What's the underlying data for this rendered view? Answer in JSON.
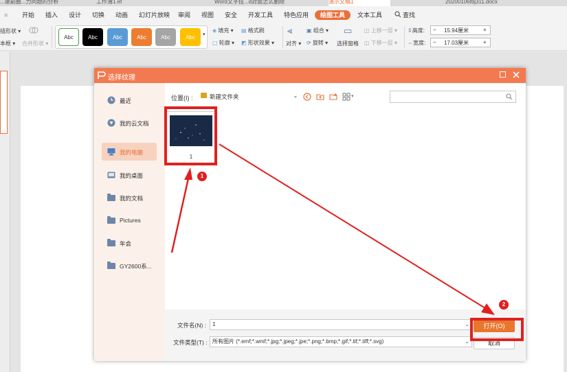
{
  "tabstrip": {
    "tabs": [
      {
        "label": "...速箭曲...力同题的分析"
      },
      {
        "label": "工作簿1.et"
      },
      {
        "label": "Word文字技...d封面怎么删除"
      },
      {
        "label": "演示文稿1"
      },
      {
        "label": "20200106fbj311.docx"
      }
    ]
  },
  "menu": {
    "items": [
      "开始",
      "插入",
      "设计",
      "切换",
      "动画",
      "幻灯片放映",
      "审阅",
      "视图",
      "安全",
      "开发工具",
      "特色应用",
      "绘图工具",
      "文本工具"
    ],
    "search": "查找"
  },
  "ribbon": {
    "shape_label": "插形状",
    "border_label": "本框",
    "merge_label": "合并形状",
    "swatch_text": "Abc",
    "swatches": [
      {
        "bg": "#ffffff",
        "fg": "#333333",
        "border": "#4a9a4a"
      },
      {
        "bg": "#000000",
        "fg": "#ffffff",
        "border": "#000000"
      },
      {
        "bg": "#5b9bd5",
        "fg": "#ffffff",
        "border": "#5b9bd5"
      },
      {
        "bg": "#ed7d31",
        "fg": "#ffffff",
        "border": "#ed7d31"
      },
      {
        "bg": "#a5a5a5",
        "fg": "#ffffff",
        "border": "#a5a5a5"
      },
      {
        "bg": "#ffc000",
        "fg": "#ffffff",
        "border": "#ffc000"
      }
    ],
    "fill": "填充",
    "format_painter": "格式刷",
    "outline": "轮廓",
    "shape_effect": "形状效果",
    "align": "对齐",
    "group": "组合",
    "rotate": "旋转",
    "selection_pane": "选择窗格",
    "bring_forward": "上移一层",
    "send_backward": "下移一层",
    "height_label": "高度:",
    "height_value": "15.94厘米",
    "width_label": "宽度:",
    "width_value": "17.03厘米"
  },
  "dialog": {
    "title": "选择纹理",
    "location_label": "位置(I) :",
    "location_value": "新建文件夹",
    "search_placeholder": "",
    "nav": [
      {
        "label": "最近",
        "icon": "clock-icon"
      },
      {
        "label": "我的云文档",
        "icon": "cloud-icon"
      },
      {
        "label": "我的电脑",
        "icon": "computer-icon"
      },
      {
        "label": "我的桌面",
        "icon": "desktop-icon"
      },
      {
        "label": "我的文档",
        "icon": "folder-icon"
      },
      {
        "label": "Pictures",
        "icon": "folder-icon"
      },
      {
        "label": "年会",
        "icon": "folder-icon"
      },
      {
        "label": "GY2600系...",
        "icon": "folder-icon"
      }
    ],
    "files": [
      {
        "name": "1"
      }
    ],
    "filename_label": "文件名(N) :",
    "filename_value": "1",
    "filetype_label": "文件类型(T) :",
    "filetype_value": "所有图片 (*.emf;*.wmf;*.jpg;*.jpeg;*.jpe;*.png;*.bmp;*.gif;*.tif;*.tiff;*.svg)",
    "open_button": "打开(O)",
    "cancel_button": "取消"
  },
  "annotations": {
    "badge1": "1",
    "badge2": "2"
  },
  "colors": {
    "accent": "#f37a50",
    "highlight": "#e02020",
    "open_button": "#e8772e"
  }
}
